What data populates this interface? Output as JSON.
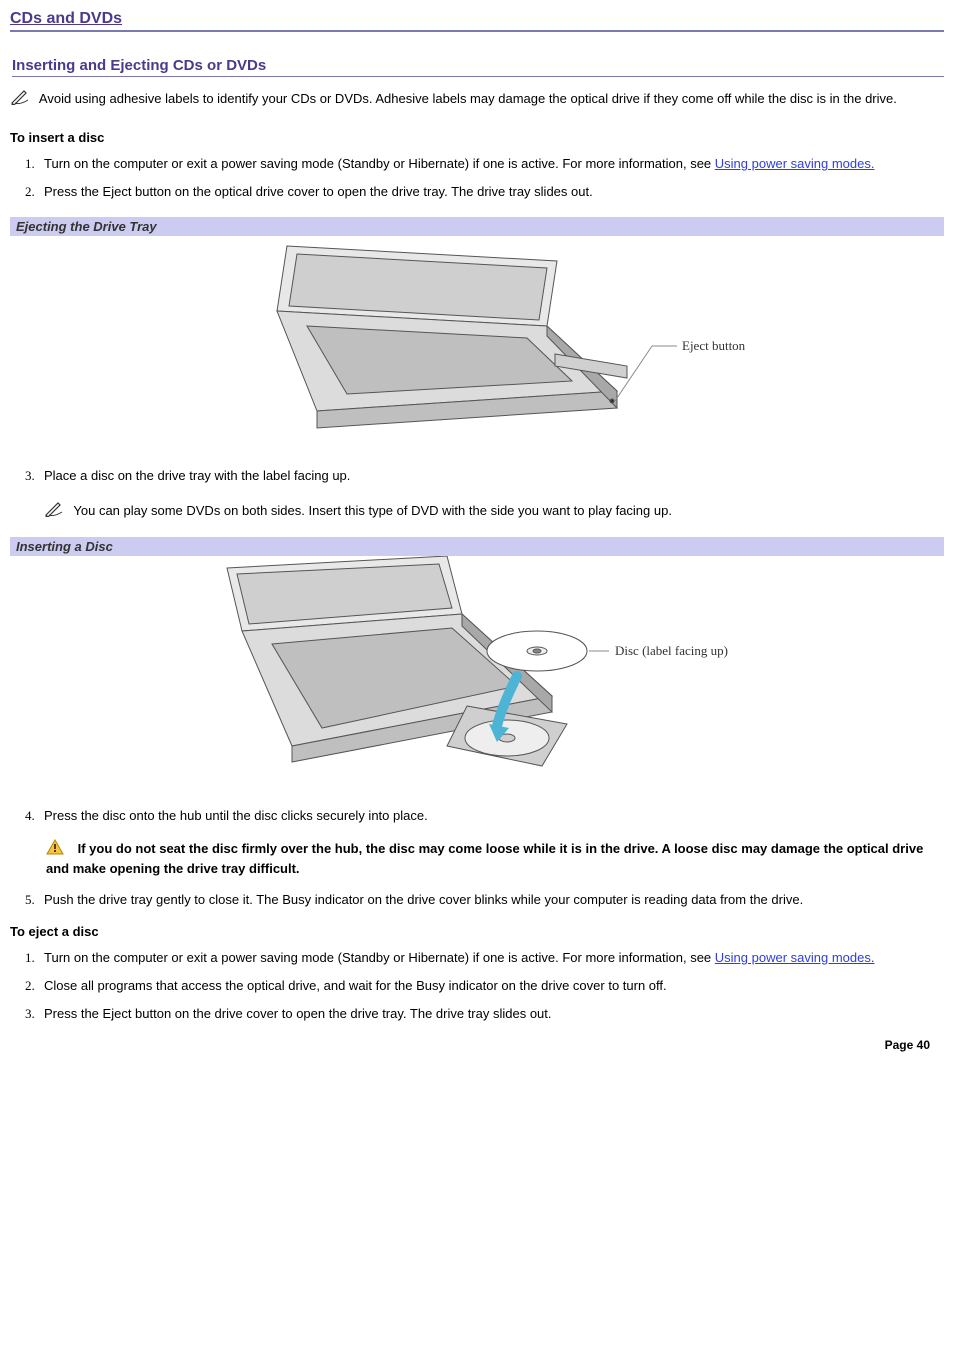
{
  "page_title": "CDs and DVDs",
  "section_heading": "Inserting and Ejecting CDs or DVDs",
  "top_note": "Avoid using adhesive labels to identify your CDs or DVDs. Adhesive labels may damage the optical drive if they come off while the disc is in the drive.",
  "insert_heading": "To insert a disc",
  "insert_steps": {
    "s1_a": "Turn on the computer or exit a power saving mode (Standby or Hibernate) if one is active. For more information, see ",
    "s1_link": "Using power saving modes.",
    "s2": "Press the Eject button on the optical drive cover to open the drive tray. The drive tray slides out.",
    "s3": "Place a disc on the drive tray with the label facing up.",
    "s3_note": "You can play some DVDs on both sides. Insert this type of DVD with the side you want to play facing up.",
    "s4": "Press the disc onto the hub until the disc clicks securely into place.",
    "s4_caution": "If you do not seat the disc firmly over the hub, the disc may come loose while it is in the drive. A loose disc may damage the optical drive and make opening the drive tray difficult.",
    "s5": "Push the drive tray gently to close it. The Busy indicator on the drive cover blinks while your computer is reading data from the drive."
  },
  "fig1_title": "Ejecting the Drive Tray",
  "fig1_label": "Eject button",
  "fig2_title": "Inserting a Disc",
  "fig2_label": "Disc (label facing up)",
  "eject_heading": "To eject a disc",
  "eject_steps": {
    "s1_a": "Turn on the computer or exit a power saving mode (Standby or Hibernate) if one is active. For more information, see ",
    "s1_link": "Using power saving modes.",
    "s2": "Close all programs that access the optical drive, and wait for the Busy indicator on the drive cover to turn off.",
    "s3": "Press the Eject button on the drive cover to open the drive tray. The drive tray slides out."
  },
  "page_number": "Page 40"
}
